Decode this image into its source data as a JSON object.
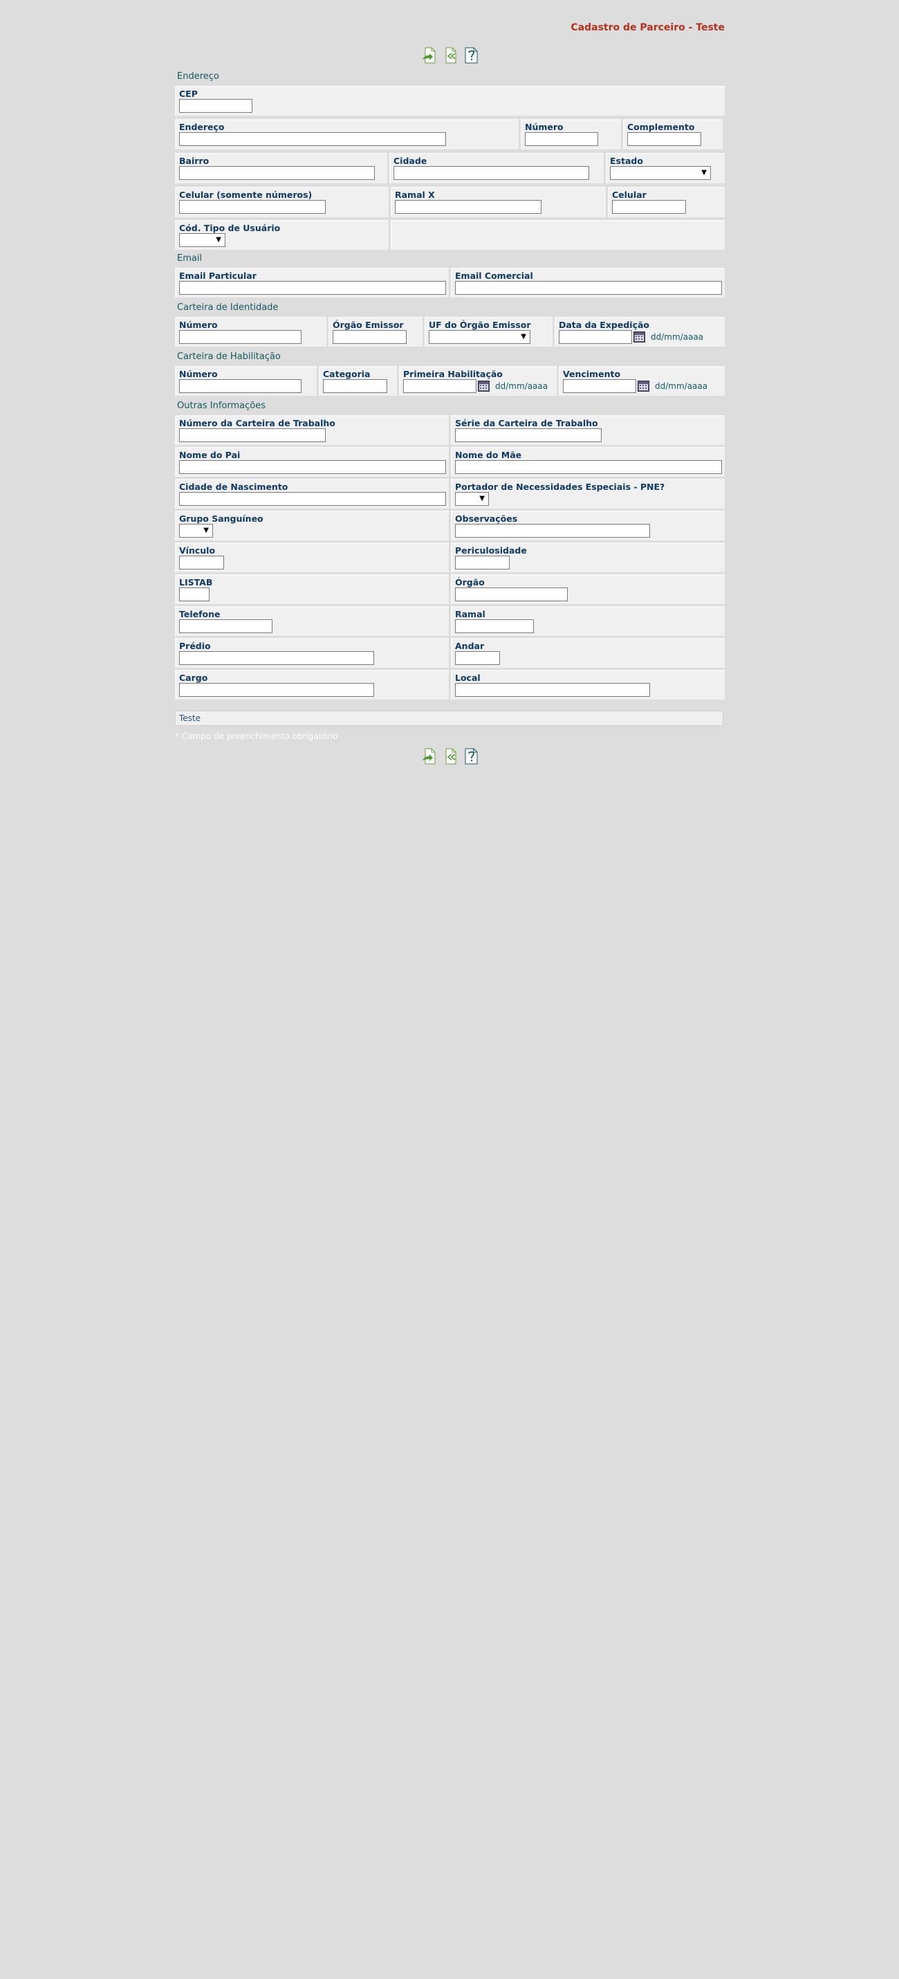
{
  "header": {
    "title": "Cadastro de Parceiro - Teste"
  },
  "toolbar": {
    "icons": [
      "save-icon",
      "back-icon",
      "help-icon"
    ]
  },
  "sections": {
    "endereco": "Endereço",
    "email": "Email",
    "identidade": "Carteira de Identidade",
    "habilitacao": "Carteira de Habilitação",
    "outras": "Outras Informações"
  },
  "labels": {
    "cep": "CEP",
    "endereco": "Endereço",
    "numero": "Número",
    "complemento": "Complemento",
    "bairro": "Bairro",
    "cidade": "Cidade",
    "estado": "Estado",
    "celular_num": "Celular (somente números)",
    "ramal_x": "Ramal X",
    "celular": "Celular",
    "cod_tipo_usuario": "Cód. Tipo de Usuário",
    "email_particular": "Email Particular",
    "email_comercial": "Email Comercial",
    "rg_numero": "Número",
    "orgao_emissor": "Órgão Emissor",
    "uf_orgao_emissor": "UF do Órgão Emissor",
    "data_expedicao": "Data da Expedição",
    "cnh_numero": "Número",
    "categoria": "Categoria",
    "primeira_habilitacao": "Primeira Habilitação",
    "vencimento": "Vencimento",
    "num_carteira_trabalho": "Número da Carteira de Trabalho",
    "serie_carteira_trabalho": "Série da Carteira de Trabalho",
    "nome_pai": "Nome do Pai",
    "nome_mae": "Nome do Mãe",
    "cidade_nascimento": "Cidade de Nascimento",
    "pne": "Portador de Necessidades Especiais - PNE?",
    "grupo_sanguineo": "Grupo Sanguíneo",
    "observacoes": "Observações",
    "vinculo": "Vínculo",
    "periculosidade": "Periculosidade",
    "listab": "LISTAB",
    "orgao": "Órgão",
    "telefone": "Telefone",
    "ramal": "Ramal",
    "predio": "Prédio",
    "andar": "Andar",
    "cargo": "Cargo",
    "local": "Local"
  },
  "date_format": "dd/mm/aaaa",
  "footer": {
    "bar_text": "Teste",
    "required_note": "* Campo de preenchimento obrigatório"
  }
}
